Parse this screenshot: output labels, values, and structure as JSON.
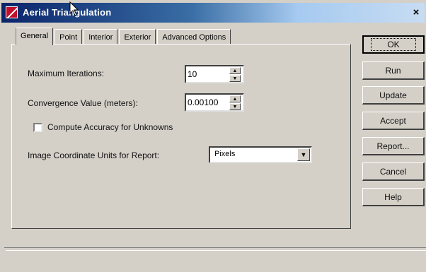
{
  "window": {
    "title": "Aerial Triangulation",
    "close_glyph": "×"
  },
  "tabs": [
    {
      "label": "General",
      "active": true
    },
    {
      "label": "Point",
      "active": false
    },
    {
      "label": "Interior",
      "active": false
    },
    {
      "label": "Exterior",
      "active": false
    },
    {
      "label": "Advanced Options",
      "active": false
    }
  ],
  "general": {
    "max_iterations_label": "Maximum Iterations:",
    "max_iterations_value": "10",
    "convergence_label": "Convergence Value (meters):",
    "convergence_value": "0.00100",
    "compute_accuracy_label": "Compute Accuracy for Unknowns",
    "compute_accuracy_checked": false,
    "image_units_label": "Image Coordinate Units for Report:",
    "image_units_value": "Pixels"
  },
  "buttons": {
    "ok": "OK",
    "run": "Run",
    "update": "Update",
    "accept": "Accept",
    "report": "Report...",
    "cancel": "Cancel",
    "help": "Help"
  },
  "status": {
    "text": ""
  },
  "icons": {
    "app": "aerial-triangulation-app-icon",
    "close": "close-icon",
    "spin_up": "spin-up-icon",
    "spin_down": "spin-down-icon",
    "dropdown": "chevron-down-icon",
    "cursor": "mouse-pointer-icon"
  },
  "colors": {
    "title_gradient_start": "#0a246a",
    "title_gradient_end": "#c7dcf2",
    "face": "#d4d0c8",
    "app_icon": "#c0102a"
  }
}
